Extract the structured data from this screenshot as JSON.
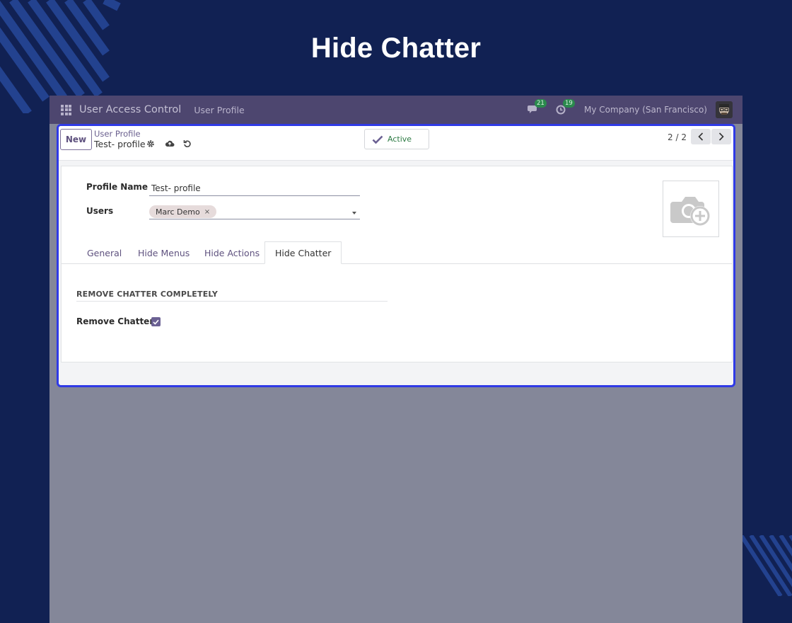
{
  "banner": {
    "title": "Hide Chatter"
  },
  "navbar": {
    "app_name": "User Access Control",
    "menu_item": "User Profile",
    "messages_count": "21",
    "activities_count": "19",
    "company": "My Company (San Francisco)"
  },
  "control_panel": {
    "new_label": "New",
    "breadcrumb_parent": "User Profile",
    "breadcrumb_current": "Test- profile",
    "status_label": "Active",
    "pager": "2 / 2"
  },
  "form": {
    "profile_name_label": "Profile Name",
    "profile_name_value": "Test- profile",
    "users_label": "Users",
    "users_tags": [
      "Marc Demo"
    ],
    "tag_remove": "×"
  },
  "tabs": [
    {
      "label": "General"
    },
    {
      "label": "Hide Menus"
    },
    {
      "label": "Hide Actions"
    },
    {
      "label": "Hide Chatter",
      "active": true
    }
  ],
  "tab_content": {
    "section_title": "REMOVE CHATTER COMPLETELY",
    "remove_chatter_label": "Remove Chatter",
    "remove_chatter_checked": true
  },
  "colors": {
    "background": "#112153",
    "navbar": "#4d466f",
    "highlight_border": "#2f3ae6",
    "accent": "#6b6193",
    "status_green": "#2c7a43"
  }
}
